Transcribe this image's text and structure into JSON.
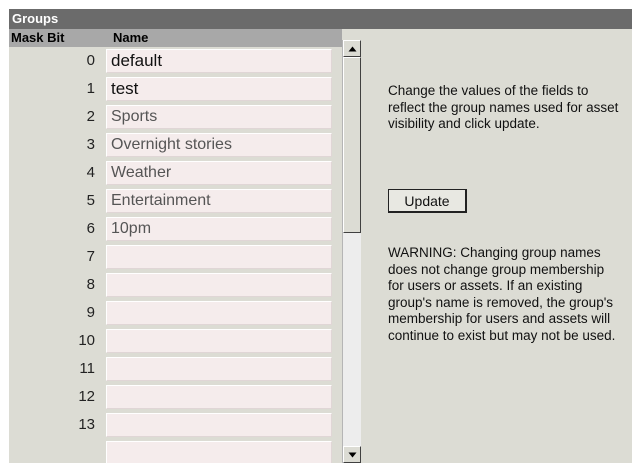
{
  "panel": {
    "title": "Groups"
  },
  "table": {
    "headers": {
      "mask_bit": "Mask Bit",
      "name": "Name"
    },
    "rows": [
      {
        "mask": "0",
        "name": "default",
        "style": "dark"
      },
      {
        "mask": "1",
        "name": "test",
        "style": "dark"
      },
      {
        "mask": "2",
        "name": "Sports",
        "style": "light"
      },
      {
        "mask": "3",
        "name": "Overnight stories",
        "style": "light"
      },
      {
        "mask": "4",
        "name": "Weather",
        "style": "light"
      },
      {
        "mask": "5",
        "name": "Entertainment",
        "style": "light"
      },
      {
        "mask": "6",
        "name": "10pm",
        "style": "light"
      },
      {
        "mask": "7",
        "name": "",
        "style": "light"
      },
      {
        "mask": "8",
        "name": "",
        "style": "light"
      },
      {
        "mask": "9",
        "name": "",
        "style": "light"
      },
      {
        "mask": "10",
        "name": "",
        "style": "light"
      },
      {
        "mask": "11",
        "name": "",
        "style": "light"
      },
      {
        "mask": "12",
        "name": "",
        "style": "light"
      },
      {
        "mask": "13",
        "name": "",
        "style": "light"
      },
      {
        "mask": "",
        "name": "",
        "style": "light"
      }
    ]
  },
  "scrollbar": {
    "up_icon": "arrow-up-icon",
    "down_icon": "arrow-down-icon"
  },
  "sidebar": {
    "instructions": "Change the values of the fields to reflect the group names used for asset visibility and click update.",
    "update_label": "Update",
    "warning": "WARNING: Changing group names does not change group membership for users or assets. If an existing group's name is removed, the group's membership for users and assets will continue to exist but may not be used."
  },
  "colors": {
    "panel_bg": "#dcdcd4",
    "title_bar_bg": "#6b6b6b",
    "header_bg": "#a8a8a8",
    "field_bg": "#f5ecec"
  }
}
